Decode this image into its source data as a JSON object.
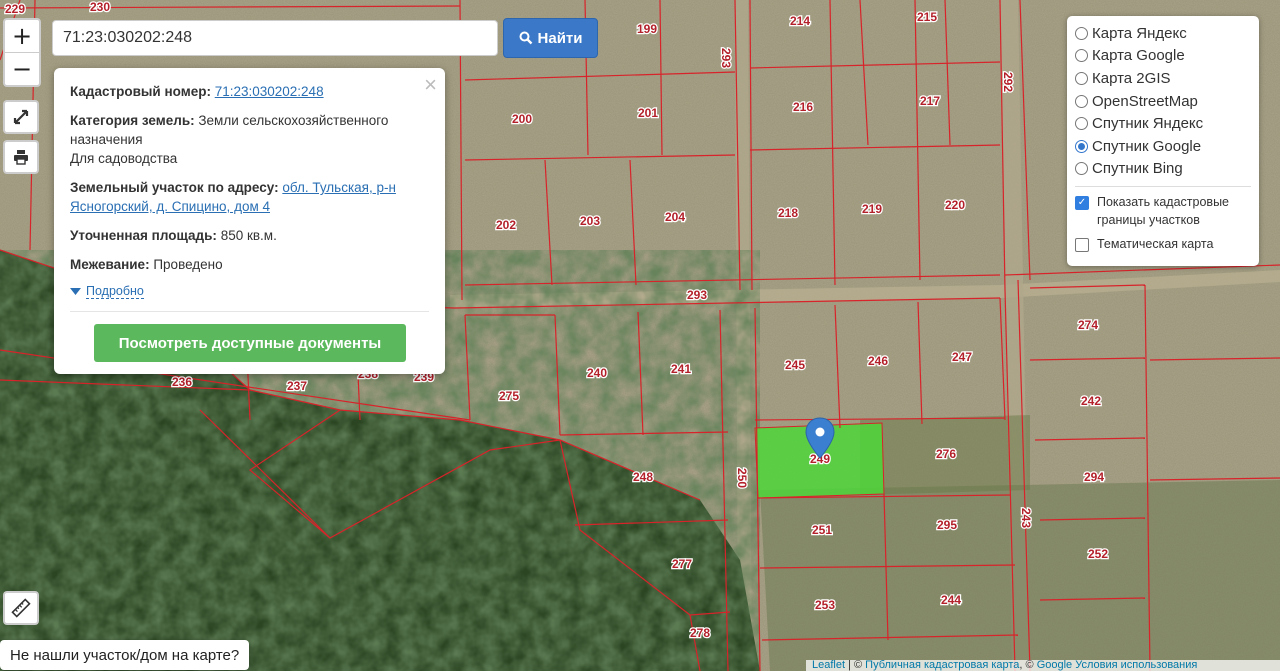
{
  "search": {
    "value": "71:23:030202:248",
    "button_label": "Найти"
  },
  "zoom": {
    "in": "+",
    "out": "−"
  },
  "popup": {
    "cadastral_label": "Кадастровый номер:",
    "cadastral_number": "71:23:030202:248",
    "category_label": "Категория земель:",
    "category_value": "Земли сельскохозяйственного назначения",
    "use": "Для садоводства",
    "address_label": "Земельный участок по адресу:",
    "address_value": "обл. Тульская, р-н Ясногорский, д. Спицино, дом 4",
    "area_label": "Уточненная площадь:",
    "area_value": "850 кв.м.",
    "survey_label": "Межевание:",
    "survey_value": "Проведено",
    "details_link": "Подробно",
    "docs_button": "Посмотреть доступные документы",
    "close": "×"
  },
  "layers": {
    "options": [
      {
        "label": "Карта Яндекс",
        "selected": false
      },
      {
        "label": "Карта Google",
        "selected": false
      },
      {
        "label": "Карта 2GIS",
        "selected": false
      },
      {
        "label": "OpenStreetMap",
        "selected": false
      },
      {
        "label": "Спутник Яндекс",
        "selected": false
      },
      {
        "label": "Спутник Google",
        "selected": true
      },
      {
        "label": "Спутник Bing",
        "selected": false
      }
    ],
    "show_borders": "Показать кадастровые границы участков",
    "show_borders_checked": true,
    "thematic": "Тематическая карта",
    "thematic_checked": false
  },
  "not_found": "Не нашли участок/дом на карте?",
  "attribution": {
    "leaflet": "Leaflet",
    "pkk": "Публичная кадастровая карта",
    "google": "Google",
    "terms": "Условия использования"
  },
  "parcels": [
    "229",
    "230",
    "199",
    "214",
    "215",
    "293",
    "201",
    "200",
    "216",
    "217",
    "292",
    "202",
    "203",
    "204",
    "218",
    "219",
    "220",
    "293",
    "274",
    "240",
    "241",
    "245",
    "246",
    "247",
    "236",
    "237",
    "238",
    "239",
    "275",
    "242",
    "248",
    "249",
    "276",
    "294",
    "250",
    "251",
    "295",
    "243",
    "277",
    "252",
    "253",
    "244",
    "278"
  ],
  "colors": {
    "boundary": "#d8232a",
    "selected_fill": "#4ed63a",
    "accent": "#3b78c7",
    "docs_button": "#5cb85c"
  },
  "icons": {
    "fullscreen": "expand-icon",
    "print": "printer-icon",
    "ruler": "ruler-icon",
    "search": "search-icon",
    "marker": "map-marker-icon"
  }
}
